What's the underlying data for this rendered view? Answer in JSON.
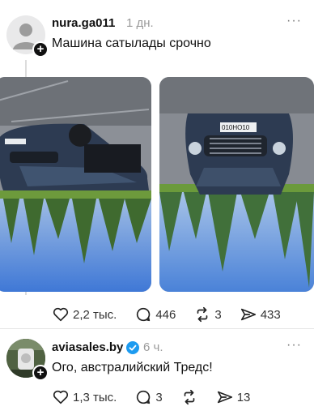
{
  "post1": {
    "username": "nura.ga011",
    "time": "1 дн.",
    "text": "Машина сатылады срочно",
    "more": "···",
    "plate_text": "010НО10",
    "actions": {
      "likes": "2,2 тыс.",
      "comments": "446",
      "reposts": "3",
      "shares": "433"
    },
    "icons": [
      "avatar-default-icon",
      "plus-icon",
      "heart-icon",
      "comment-icon",
      "repost-icon",
      "share-icon"
    ]
  },
  "post2": {
    "username": "aviasales.by",
    "time": "6 ч.",
    "text": "Ого, австралийский Тредс!",
    "more": "···",
    "actions": {
      "likes": "1,3 тыс.",
      "comments": "3",
      "reposts": "",
      "shares": "13"
    },
    "icons": [
      "verified-badge-icon",
      "plus-icon",
      "heart-icon",
      "comment-icon",
      "repost-icon",
      "share-icon"
    ]
  },
  "colors": {
    "verified": "#1d9bf0",
    "sky": "#5b8fe0",
    "grass": "#5a8a3a",
    "car": "#2d3b52"
  }
}
